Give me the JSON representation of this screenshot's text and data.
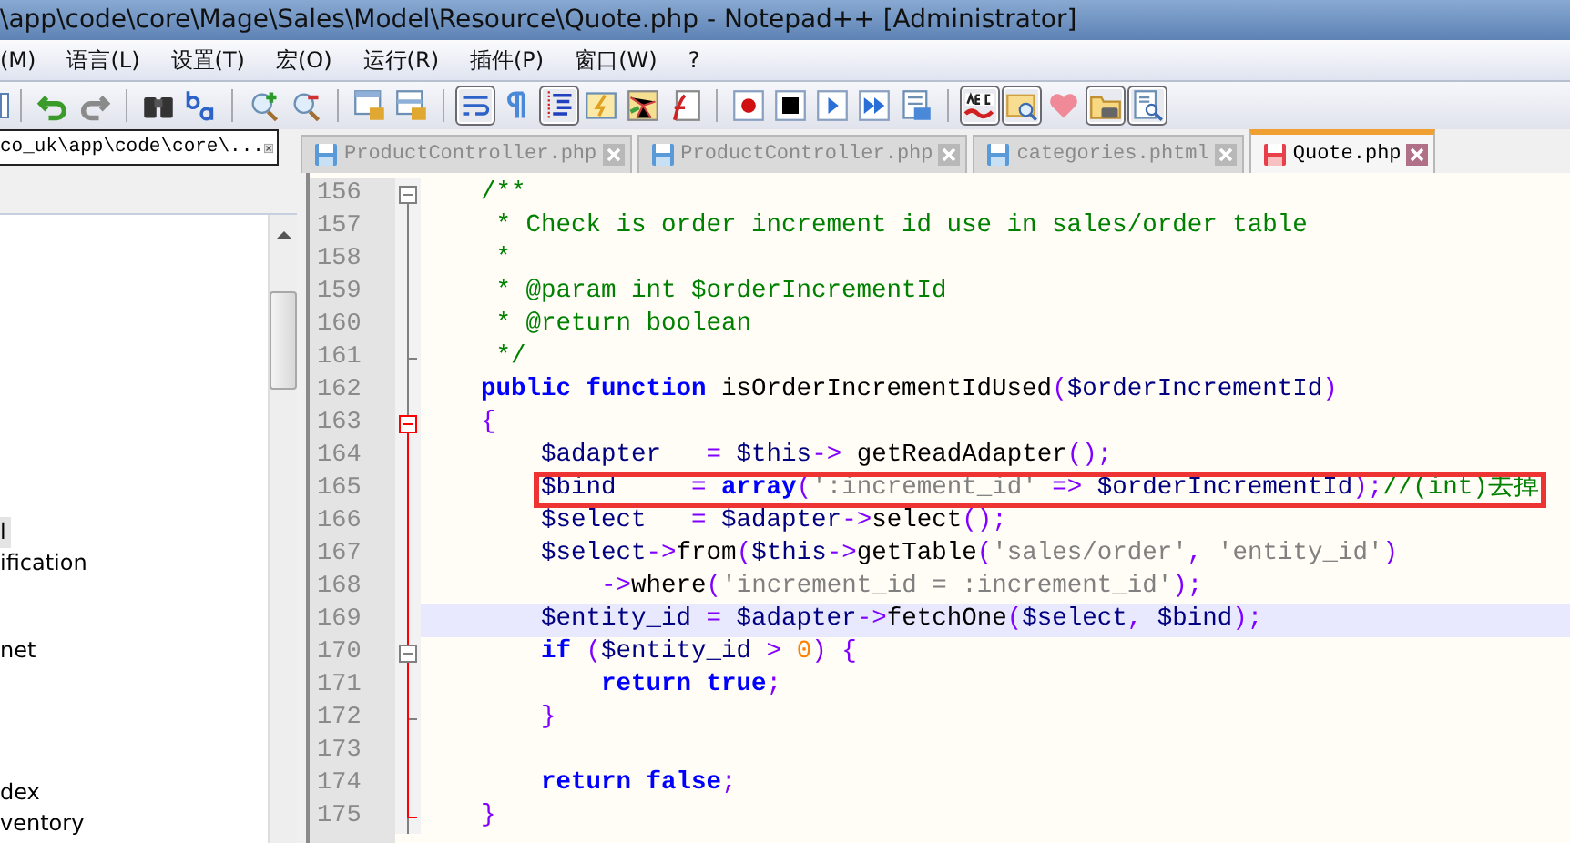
{
  "window": {
    "title": "\\app\\code\\core\\Mage\\Sales\\Model\\Resource\\Quote.php - Notepad++ [Administrator]"
  },
  "menu": [
    "(M)",
    "语言(L)",
    "设置(T)",
    "宏(O)",
    "运行(R)",
    "插件(P)",
    "窗口(W)",
    "?"
  ],
  "toolbar": [
    [
      {
        "kind": "undo",
        "pressed": false
      },
      {
        "kind": "redo",
        "pressed": false
      }
    ],
    [
      {
        "kind": "find",
        "pressed": false
      },
      {
        "kind": "replace",
        "pressed": false
      }
    ],
    [
      {
        "kind": "zoom-in",
        "pressed": false
      },
      {
        "kind": "zoom-out",
        "pressed": false
      }
    ],
    [
      {
        "kind": "sync-v",
        "pressed": false
      },
      {
        "kind": "sync-h",
        "pressed": false
      }
    ],
    [
      {
        "kind": "wrap",
        "pressed": true
      },
      {
        "kind": "pilcrow",
        "pressed": false
      },
      {
        "kind": "indent",
        "pressed": true
      },
      {
        "kind": "lang",
        "pressed": false
      },
      {
        "kind": "map",
        "pressed": false
      },
      {
        "kind": "func",
        "pressed": false
      }
    ],
    [
      {
        "kind": "record",
        "pressed": false
      },
      {
        "kind": "stop",
        "pressed": false
      },
      {
        "kind": "play",
        "pressed": false
      },
      {
        "kind": "play-multi",
        "pressed": false
      },
      {
        "kind": "save-macro",
        "pressed": false
      }
    ],
    [
      {
        "kind": "spell",
        "pressed": true
      },
      {
        "kind": "find-files",
        "pressed": true
      },
      {
        "kind": "heart",
        "pressed": false
      },
      {
        "kind": "folder",
        "pressed": true
      },
      {
        "kind": "doc-search",
        "pressed": true
      }
    ]
  ],
  "side_panel": {
    "title": "co_uk\\app\\code\\core\\...",
    "items": [
      {
        "label": "l",
        "selected": true
      },
      {
        "label": "ification",
        "selected": false
      },
      {
        "label": "net",
        "selected": false
      },
      {
        "label": "dex",
        "selected": false
      },
      {
        "label": "ventory",
        "selected": false
      }
    ]
  },
  "tabs": [
    {
      "label": "ProductController.php",
      "selected": false
    },
    {
      "label": "ProductController.php",
      "selected": false
    },
    {
      "label": "categories.phtml",
      "selected": false
    },
    {
      "label": "Quote.php",
      "selected": true
    }
  ],
  "lines": [
    {
      "number": "156",
      "kind": "fold",
      "current": false,
      "boxed": false,
      "tokens": [
        {
          "text": "    /**",
          "kind": "comment"
        }
      ]
    },
    {
      "number": "157",
      "kind": "plain",
      "current": false,
      "boxed": false,
      "tokens": [
        {
          "text": "     * Check is order increment id use in sales/order table",
          "kind": "comment"
        }
      ]
    },
    {
      "number": "158",
      "kind": "plain",
      "current": false,
      "boxed": false,
      "tokens": [
        {
          "text": "     *",
          "kind": "comment"
        }
      ]
    },
    {
      "number": "159",
      "kind": "plain",
      "current": false,
      "boxed": false,
      "tokens": [
        {
          "text": "     * @param int $orderIncrementId",
          "kind": "comment"
        }
      ]
    },
    {
      "number": "160",
      "kind": "plain",
      "current": false,
      "boxed": false,
      "tokens": [
        {
          "text": "     * @return boolean",
          "kind": "comment"
        }
      ]
    },
    {
      "number": "161",
      "kind": "end",
      "current": false,
      "boxed": false,
      "tokens": [
        {
          "text": "     */",
          "kind": "comment"
        }
      ]
    },
    {
      "number": "162",
      "kind": "plain",
      "current": false,
      "boxed": false,
      "tokens": [
        {
          "text": "    public function",
          "kind": "keyword"
        },
        {
          "text": " isOrderIncrementIdUsed",
          "kind": "plain"
        },
        {
          "text": "(",
          "kind": "operator"
        },
        {
          "text": "$orderIncrementId",
          "kind": "variable"
        },
        {
          "text": ")",
          "kind": "operator"
        }
      ]
    },
    {
      "number": "163",
      "kind": "fold-red",
      "current": false,
      "boxed": false,
      "tokens": [
        {
          "text": "    {",
          "kind": "operator"
        }
      ]
    },
    {
      "number": "164",
      "kind": "red",
      "current": false,
      "boxed": false,
      "tokens": [
        {
          "text": "        $adapter",
          "kind": "variable"
        },
        {
          "text": "   = ",
          "kind": "operator"
        },
        {
          "text": "$this",
          "kind": "variable"
        },
        {
          "text": "->",
          "kind": "operator"
        },
        {
          "text": " getReadAdapter",
          "kind": "plain"
        },
        {
          "text": "();",
          "kind": "operator"
        }
      ]
    },
    {
      "number": "165",
      "kind": "red",
      "current": false,
      "boxed": true,
      "tokens": [
        {
          "text": "        $bind",
          "kind": "variable"
        },
        {
          "text": "     = ",
          "kind": "operator"
        },
        {
          "text": "array",
          "kind": "keyword"
        },
        {
          "text": "(",
          "kind": "operator"
        },
        {
          "text": "':increment_id'",
          "kind": "string"
        },
        {
          "text": " => ",
          "kind": "operator"
        },
        {
          "text": "$orderIncrementId",
          "kind": "variable"
        },
        {
          "text": ");",
          "kind": "operator"
        },
        {
          "text": "//(int)去掉",
          "kind": "comment"
        }
      ]
    },
    {
      "number": "166",
      "kind": "red",
      "current": false,
      "boxed": false,
      "tokens": [
        {
          "text": "        $select",
          "kind": "variable"
        },
        {
          "text": "   = ",
          "kind": "operator"
        },
        {
          "text": "$adapter",
          "kind": "variable"
        },
        {
          "text": "->",
          "kind": "operator"
        },
        {
          "text": "select",
          "kind": "plain"
        },
        {
          "text": "();",
          "kind": "operator"
        }
      ]
    },
    {
      "number": "167",
      "kind": "red",
      "current": false,
      "boxed": false,
      "tokens": [
        {
          "text": "        $select",
          "kind": "variable"
        },
        {
          "text": "->",
          "kind": "operator"
        },
        {
          "text": "from",
          "kind": "plain"
        },
        {
          "text": "(",
          "kind": "operator"
        },
        {
          "text": "$this",
          "kind": "variable"
        },
        {
          "text": "->",
          "kind": "operator"
        },
        {
          "text": "getTable",
          "kind": "plain"
        },
        {
          "text": "(",
          "kind": "operator"
        },
        {
          "text": "'sales/order'",
          "kind": "string"
        },
        {
          "text": ", ",
          "kind": "operator"
        },
        {
          "text": "'entity_id'",
          "kind": "string"
        },
        {
          "text": ")",
          "kind": "operator"
        }
      ]
    },
    {
      "number": "168",
      "kind": "red",
      "current": false,
      "boxed": false,
      "tokens": [
        {
          "text": "            ->",
          "kind": "operator"
        },
        {
          "text": "where",
          "kind": "plain"
        },
        {
          "text": "(",
          "kind": "operator"
        },
        {
          "text": "'increment_id = :increment_id'",
          "kind": "string"
        },
        {
          "text": ");",
          "kind": "operator"
        }
      ]
    },
    {
      "number": "169",
      "kind": "red",
      "current": true,
      "boxed": false,
      "tokens": [
        {
          "text": "        $entity_id",
          "kind": "variable"
        },
        {
          "text": " = ",
          "kind": "operator"
        },
        {
          "text": "$adapter",
          "kind": "variable"
        },
        {
          "text": "->",
          "kind": "operator"
        },
        {
          "text": "fetchOne",
          "kind": "plain"
        },
        {
          "text": "(",
          "kind": "operator"
        },
        {
          "text": "$select",
          "kind": "variable"
        },
        {
          "text": ", ",
          "kind": "operator"
        },
        {
          "text": "$bind",
          "kind": "variable"
        },
        {
          "text": ");",
          "kind": "operator"
        }
      ]
    },
    {
      "number": "170",
      "kind": "fold-inner",
      "current": false,
      "boxed": false,
      "tokens": [
        {
          "text": "        if",
          "kind": "keyword"
        },
        {
          "text": " (",
          "kind": "operator"
        },
        {
          "text": "$entity_id",
          "kind": "variable"
        },
        {
          "text": " > ",
          "kind": "operator"
        },
        {
          "text": "0",
          "kind": "number"
        },
        {
          "text": ") {",
          "kind": "operator"
        }
      ]
    },
    {
      "number": "171",
      "kind": "red",
      "current": false,
      "boxed": false,
      "tokens": [
        {
          "text": "            return true",
          "kind": "keyword"
        },
        {
          "text": ";",
          "kind": "operator"
        }
      ]
    },
    {
      "number": "172",
      "kind": "end-inner",
      "current": false,
      "boxed": false,
      "tokens": [
        {
          "text": "        }",
          "kind": "operator"
        }
      ]
    },
    {
      "number": "173",
      "kind": "red",
      "current": false
    },
    {
      "number": "174",
      "kind": "red",
      "current": false,
      "boxed": false,
      "tokens": [
        {
          "text": "        return false",
          "kind": "keyword"
        },
        {
          "text": ";",
          "kind": "operator"
        }
      ]
    },
    {
      "number": "175",
      "kind": "end-red",
      "current": false,
      "boxed": false,
      "tokens": [
        {
          "text": "    }",
          "kind": "operator"
        }
      ]
    }
  ]
}
